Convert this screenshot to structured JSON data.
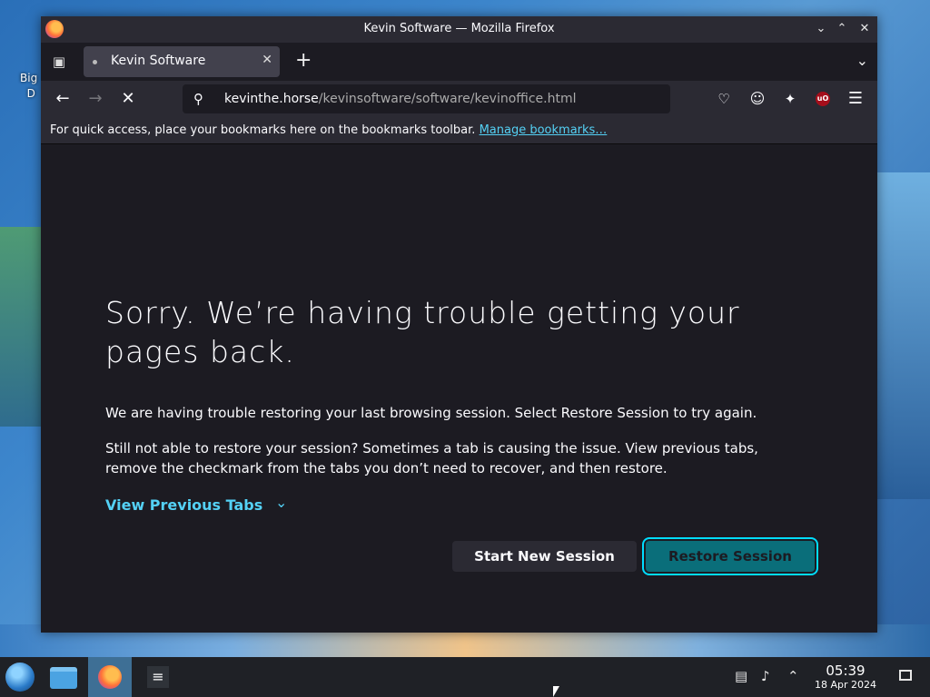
{
  "desktop": {
    "icon_label": "Big\nD"
  },
  "window": {
    "title": "Kevin Software — Mozilla Firefox"
  },
  "tab": {
    "label": "Kevin Software"
  },
  "url": {
    "host": "kevinthe.horse",
    "path": "/kevinsoftware/software/kevinoffice.html"
  },
  "bookmarks": {
    "message": "For quick access, place your bookmarks here on the bookmarks toolbar.",
    "link": "Manage bookmarks…"
  },
  "page": {
    "heading": "Sorry. We’re having trouble getting your pages back.",
    "p1": "We are having trouble restoring your last browsing session. Select Restore Session to try again.",
    "p2": "Still not able to restore your session? Sometimes a tab is causing the issue. View previous tabs, remove the checkmark from the tabs you don’t need to recover, and then restore.",
    "view_previous": "View Previous Tabs",
    "start_new": "Start New Session",
    "restore": "Restore Session"
  },
  "taskbar": {
    "time": "05:39",
    "date": "18 Apr 2024"
  },
  "colors": {
    "accent": "#00ddff",
    "link": "#54d1f5",
    "primary_btn": "#0a6e7a"
  },
  "icons": [
    "firefox-icon",
    "minimize-icon",
    "maximize-icon",
    "close-icon",
    "tab-list-icon",
    "new-tab-icon",
    "back-icon",
    "forward-icon",
    "stop-icon",
    "search-icon",
    "pocket-icon",
    "account-icon",
    "extensions-icon",
    "ublock-icon",
    "menu-icon"
  ]
}
